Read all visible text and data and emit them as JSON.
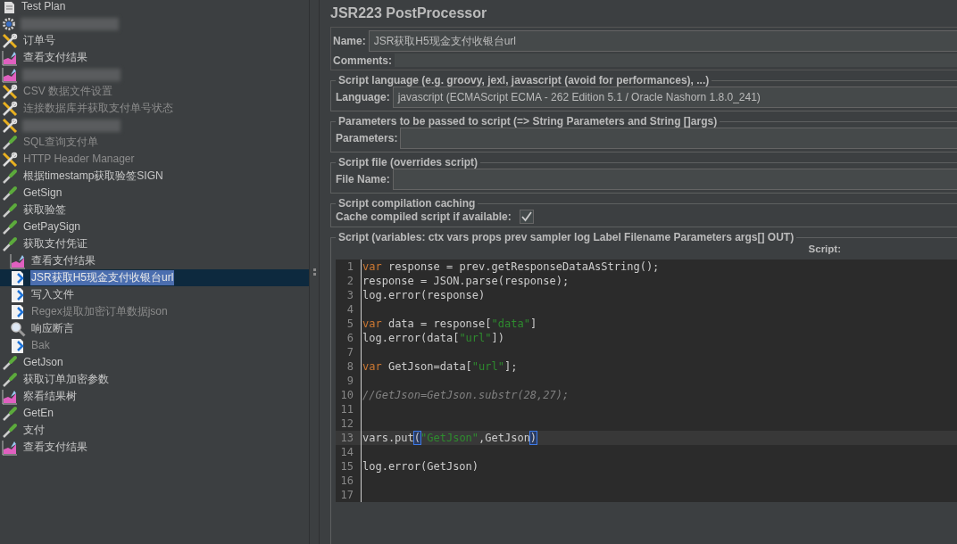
{
  "tree": {
    "items": [
      {
        "label": "Test Plan",
        "kind": "plan",
        "selected": false,
        "disabled": false
      },
      {
        "kind": "gear",
        "selected": false,
        "disabled": false
      },
      {
        "label": "订单号",
        "kind": "config",
        "selected": false,
        "disabled": false
      },
      {
        "label": "查看支付结果",
        "kind": "listener",
        "selected": false,
        "disabled": false
      },
      {
        "kind": "listener",
        "selected": false,
        "disabled": false
      },
      {
        "label": "CSV 数据文件设置",
        "kind": "config",
        "selected": false,
        "disabled": true
      },
      {
        "label": "连接数据库并获取支付单号状态",
        "kind": "config",
        "selected": false,
        "disabled": true
      },
      {
        "kind": "config",
        "selected": false,
        "disabled": false
      },
      {
        "label": "SQL查询支付单",
        "kind": "sampler",
        "selected": false,
        "disabled": true
      },
      {
        "label": "HTTP Header Manager",
        "kind": "config",
        "selected": false,
        "disabled": true
      },
      {
        "label": "根据timestamp获取验签SIGN",
        "kind": "sampler",
        "selected": false,
        "disabled": false
      },
      {
        "label": "GetSign",
        "kind": "sampler",
        "selected": false,
        "disabled": false
      },
      {
        "label": "获取验签",
        "kind": "sampler",
        "selected": false,
        "disabled": false
      },
      {
        "label": "GetPaySign",
        "kind": "sampler",
        "selected": false,
        "disabled": false
      },
      {
        "label": "获取支付凭证",
        "kind": "sampler",
        "selected": false,
        "disabled": false,
        "children": [
          {
            "label": "查看支付结果",
            "kind": "listener",
            "selected": false,
            "disabled": false
          },
          {
            "label": "JSR获取H5现金支付收银台url",
            "kind": "processor",
            "selected": true,
            "disabled": false
          },
          {
            "label": "写入文件",
            "kind": "processor",
            "selected": false,
            "disabled": false
          },
          {
            "label": "Regex提取加密订单数据json",
            "kind": "processor",
            "selected": false,
            "disabled": true
          },
          {
            "label": "响应断言",
            "kind": "assertion",
            "selected": false,
            "disabled": false
          },
          {
            "label": "Bak",
            "kind": "processor",
            "selected": false,
            "disabled": true
          }
        ]
      },
      {
        "label": "GetJson",
        "kind": "sampler",
        "selected": false,
        "disabled": false
      },
      {
        "label": "获取订单加密参数",
        "kind": "sampler",
        "selected": false,
        "disabled": false
      },
      {
        "label": "察看结果树",
        "kind": "listener",
        "selected": false,
        "disabled": false
      },
      {
        "label": "GetEn",
        "kind": "sampler",
        "selected": false,
        "disabled": false
      },
      {
        "label": "支付",
        "kind": "sampler",
        "selected": false,
        "disabled": false
      },
      {
        "label": "查看支付结果",
        "kind": "listener",
        "selected": false,
        "disabled": false
      }
    ]
  },
  "panel": {
    "title": "JSR223 PostProcessor",
    "name": {
      "label": "Name:",
      "value": "JSR获取H5现金支付收银台url"
    },
    "comments": {
      "label": "Comments:"
    },
    "language_group": {
      "title": "Script language (e.g. groovy, jexl, javascript (avoid for performances), ...)",
      "label": "Language:",
      "value": "javascript     (ECMAScript ECMA - 262 Edition 5.1 / Oracle Nashorn 1.8.0_241)"
    },
    "parameters_group": {
      "title": "Parameters to be passed to script (=> String Parameters and String []args)",
      "label": "Parameters:"
    },
    "file_group": {
      "title": "Script file (overrides script)",
      "label": "File Name:"
    },
    "caching_group": {
      "title": "Script compilation caching",
      "label": "Cache compiled script if available:",
      "checked": true
    },
    "script_group": {
      "title": "Script (variables: ctx vars props prev sampler log Label Filename Parameters args[] OUT)",
      "label": "Script:",
      "lines": [
        {
          "number": "1",
          "current": false,
          "tokens": [
            {
              "kind": "keyword",
              "text": "var"
            },
            {
              "kind": "plain",
              "text": " response = prev.getResponseDataAsString();"
            }
          ]
        },
        {
          "number": "2",
          "current": false,
          "tokens": [
            {
              "kind": "plain",
              "text": "response = JSON.parse(response);"
            }
          ]
        },
        {
          "number": "3",
          "current": false,
          "tokens": [
            {
              "kind": "plain",
              "text": "log.error(response)"
            }
          ]
        },
        {
          "number": "4",
          "current": false
        },
        {
          "number": "5",
          "current": false,
          "tokens": [
            {
              "kind": "keyword",
              "text": "var"
            },
            {
              "kind": "plain",
              "text": " data = response["
            },
            {
              "kind": "string",
              "text": "\"data\""
            },
            {
              "kind": "plain",
              "text": "]"
            }
          ]
        },
        {
          "number": "6",
          "current": false,
          "tokens": [
            {
              "kind": "plain",
              "text": "log.error(data["
            },
            {
              "kind": "string",
              "text": "\"url\""
            },
            {
              "kind": "plain",
              "text": "])"
            }
          ]
        },
        {
          "number": "7",
          "current": false
        },
        {
          "number": "8",
          "current": false,
          "tokens": [
            {
              "kind": "keyword",
              "text": "var"
            },
            {
              "kind": "plain",
              "text": " GetJson=data["
            },
            {
              "kind": "string",
              "text": "\"url\""
            },
            {
              "kind": "plain",
              "text": "];"
            }
          ]
        },
        {
          "number": "9",
          "current": false
        },
        {
          "number": "10",
          "current": false,
          "tokens": [
            {
              "kind": "comment",
              "text": "//GetJson=GetJson.substr(28,27);"
            }
          ]
        },
        {
          "number": "11",
          "current": false
        },
        {
          "number": "12",
          "current": false
        },
        {
          "number": "13",
          "current": true,
          "tokens": [
            {
              "kind": "plain",
              "text": "vars.put"
            },
            {
              "kind": "bracket",
              "text": "("
            },
            {
              "kind": "string",
              "text": "\"GetJson\""
            },
            {
              "kind": "plain",
              "text": ",GetJson"
            },
            {
              "kind": "bracket",
              "text": ")"
            }
          ]
        },
        {
          "number": "14",
          "current": false
        },
        {
          "number": "15",
          "current": false,
          "tokens": [
            {
              "kind": "plain",
              "text": "log.error(GetJson)"
            }
          ]
        },
        {
          "number": "16",
          "current": false
        },
        {
          "number": "17",
          "current": false
        }
      ]
    }
  }
}
